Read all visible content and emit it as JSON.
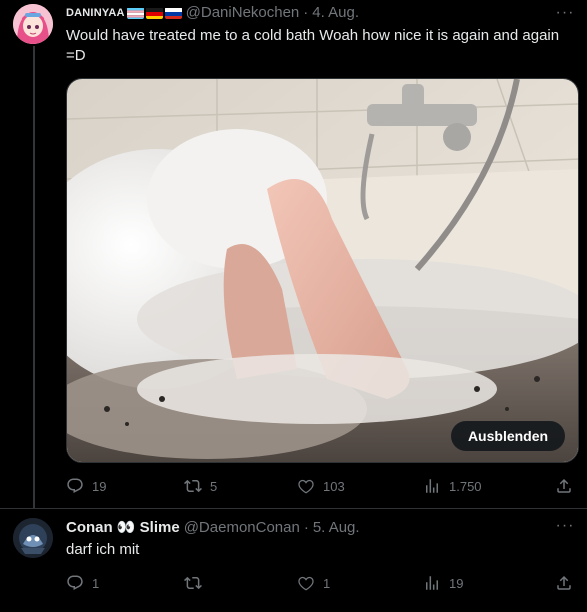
{
  "tweet1": {
    "display_name": "DANINYAA",
    "flags": [
      "trans-flag",
      "germany-flag",
      "russia-flag"
    ],
    "handle": "@DaniNekochen",
    "separator": "·",
    "date": "4. Aug.",
    "text": "Would have treated me to a cold bath Woah how nice it is again and again =D",
    "media_button": "Ausblenden",
    "replies": "19",
    "retweets": "5",
    "likes": "103",
    "views": "1.750"
  },
  "tweet2": {
    "display_name": "Conan 👀 Slime",
    "handle": "@DaemonConan",
    "separator": "·",
    "date": "5. Aug.",
    "text": "darf ich mit",
    "replies": "1",
    "retweets": "",
    "likes": "1",
    "views": "19"
  },
  "icons": [
    "more-icon",
    "reply-icon",
    "retweet-icon",
    "like-icon",
    "views-icon",
    "share-icon"
  ],
  "colors": {
    "background": "#000000",
    "text": "#e7e9ea",
    "muted": "#71767b",
    "divider": "#2f3336"
  }
}
